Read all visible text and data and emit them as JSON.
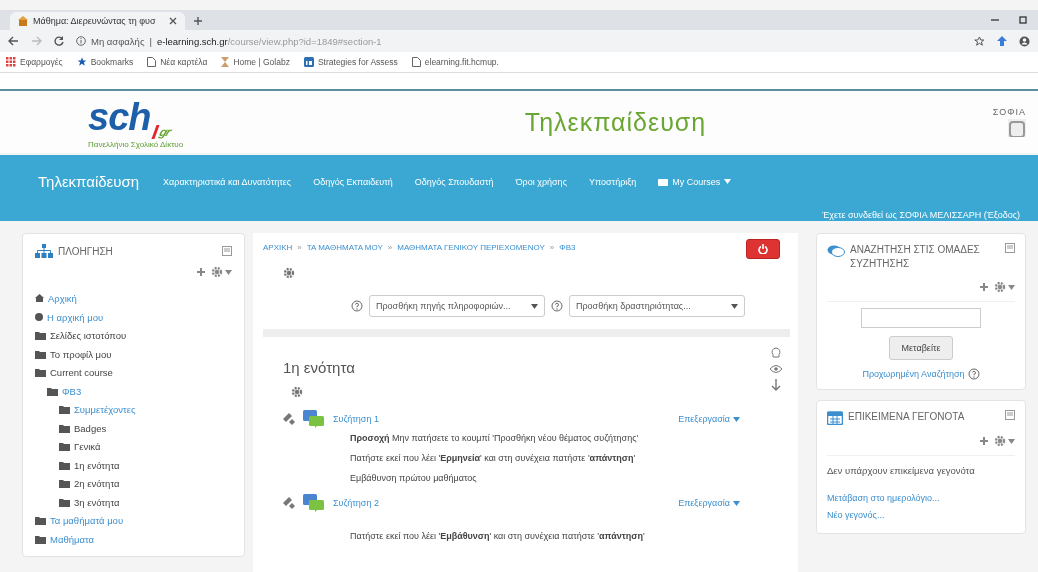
{
  "browser": {
    "tab": {
      "title": "Μάθημα: Διερευνώντας τη φυσ"
    },
    "address": {
      "security": "Μη ασφαλής",
      "separator": "|",
      "host": "e-learning.sch.gr",
      "path": "/course/view.php?id=1849#section-1"
    },
    "bookmarks": [
      {
        "label": "Εφαρμογές",
        "kind": "apps"
      },
      {
        "label": "Bookmarks",
        "kind": "star"
      },
      {
        "label": "Νέα καρτέλα",
        "kind": "page"
      },
      {
        "label": "Home | Golabz",
        "kind": "hourglass"
      },
      {
        "label": "Strategies for Assess",
        "kind": "square"
      },
      {
        "label": "elearning.fit.hcmup.",
        "kind": "page"
      }
    ]
  },
  "header": {
    "logo": {
      "mark": "sch",
      "suffix": "gr",
      "tagline": "Πανελλήνιο Σχολικό Δίκτυο"
    },
    "title": "Τηλεκπαίδευση",
    "user": "ΣΟΦΙΑ"
  },
  "navbar": {
    "brand": "Τηλεκπαίδευση",
    "links": [
      {
        "label": "Χαρακτηριστικά και Δυνατότητες",
        "kind": "link"
      },
      {
        "label": "Οδηγός Εκπαιδευτή",
        "kind": "link"
      },
      {
        "label": "Οδηγός Σπουδαστή",
        "kind": "link"
      },
      {
        "label": "Όροι χρήσης",
        "kind": "link"
      },
      {
        "label": "Υποστήριξη",
        "kind": "link"
      },
      {
        "label": "My Courses",
        "kind": "menu"
      }
    ],
    "login": {
      "text": "Έχετε συνδεθεί ως ΣΟΦΙΑ ΜΕΛΙΣΣΑΡΗ",
      "logout": "(Έξοδος)"
    }
  },
  "navigation": {
    "title": "ΠΛΟΗΓΗΣΗ",
    "items": [
      {
        "label": "Αρχική",
        "link": true,
        "kind": "home"
      },
      {
        "label": "Η αρχική μου",
        "link": true,
        "kind": "dot"
      },
      {
        "label": "Σελίδες ιστοτόπου",
        "link": false,
        "kind": "folder"
      },
      {
        "label": "Το προφίλ μου",
        "link": false,
        "kind": "folder"
      },
      {
        "label": "Current course",
        "link": false,
        "kind": "folder",
        "children": [
          {
            "label": "ΦΒ3",
            "link": true,
            "kind": "folder",
            "children": [
              {
                "label": "Συμμετέχοντες",
                "link": true,
                "kind": "folder"
              },
              {
                "label": "Badges",
                "link": false,
                "kind": "folder"
              },
              {
                "label": "Γενικά",
                "link": false,
                "kind": "folder"
              },
              {
                "label": "1η ενότητα",
                "link": false,
                "kind": "folder"
              },
              {
                "label": "2η ενότητα",
                "link": false,
                "kind": "folder"
              },
              {
                "label": "3η ενότητα",
                "link": false,
                "kind": "folder"
              }
            ]
          }
        ]
      },
      {
        "label": "Τα μαθήματά μου",
        "link": true,
        "kind": "folder"
      },
      {
        "label": "Μαθήματα",
        "link": true,
        "kind": "folder"
      }
    ]
  },
  "breadcrumb": {
    "separator": "»",
    "items": [
      "ΑΡΧΙΚΗ",
      "ΤΑ ΜΑΘΗΜΑΤΑ ΜΟΥ",
      "ΜΑΘΗΜΑΤΑ ΓΕΝΙΚΟΥ ΠΕΡΙΕΧΟΜΕΝΟΥ",
      "ΦΒ3"
    ]
  },
  "selects": [
    {
      "value": "Προσθήκη πηγής πληροφοριών..."
    },
    {
      "value": "Προσθήκη δραστηριότητας..."
    }
  ],
  "section": {
    "title": "1η ενότητα",
    "activities": [
      {
        "title": "Συζήτηση 1",
        "edit": "Επεξεργασία",
        "lines": [
          "**Προσοχή** Μην πατήσετε το κουμπί 'Προσθήκη νέου θέματος συζήτησης'",
          "Πατήστε εκεί που λέει '**Ερμηνεία**' και στη συνέχεια πατήστε '**απάντηση**'",
          "Εμβάθυνση πρώτου μαθήματος"
        ]
      },
      {
        "title": "Συζήτηση 2",
        "edit": "Επεξεργασία",
        "lines": [
          "Πατήστε εκεί που λέει '**Εμβάθυνση**' και στη συνέχεια πατήστε '**απάντηση**'"
        ]
      }
    ]
  },
  "search_block": {
    "title": "ΑΝΑΖΗΤΗΣΗ ΣΤΙΣ ΟΜΑΔΕΣ ΣΥΖΗΤΗΣΗΣ",
    "button": "Μεταβείτε",
    "advanced": "Προχωρημένη Αναζήτηση"
  },
  "events_block": {
    "title": "ΕΠΙΚΕΙΜΕΝΑ ΓΕΓΟΝΟΤΑ",
    "message": "Δεν υπάρχουν επικείμενα γεγονότα",
    "links": [
      "Μετάβαση στο ημερολόγιο...",
      "Νέο γεγονός..."
    ]
  }
}
